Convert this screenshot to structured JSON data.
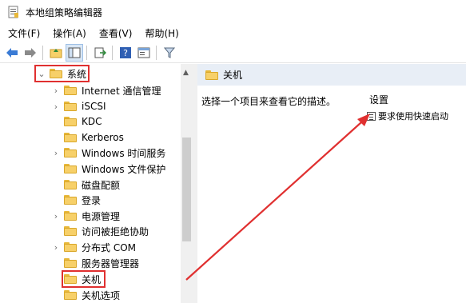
{
  "window": {
    "title": "本地组策略编辑器"
  },
  "menu": [
    "文件(F)",
    "操作(A)",
    "查看(V)",
    "帮助(H)"
  ],
  "toolbar": [
    "back-arrow-icon",
    "forward-arrow-icon",
    "up-folder-icon",
    "show-hide-tree-icon",
    "export-list-icon",
    "help-icon",
    "properties-pane-icon",
    "filter-icon"
  ],
  "tree": {
    "root": "系统",
    "items": [
      {
        "label": "Internet 通信管理",
        "expandable": true
      },
      {
        "label": "iSCSI",
        "expandable": true
      },
      {
        "label": "KDC",
        "expandable": false
      },
      {
        "label": "Kerberos",
        "expandable": false
      },
      {
        "label": "Windows 时间服务",
        "expandable": true
      },
      {
        "label": "Windows 文件保护",
        "expandable": false
      },
      {
        "label": "磁盘配额",
        "expandable": false
      },
      {
        "label": "登录",
        "expandable": false
      },
      {
        "label": "电源管理",
        "expandable": true
      },
      {
        "label": "访问被拒绝协助",
        "expandable": false
      },
      {
        "label": "分布式 COM",
        "expandable": true
      },
      {
        "label": "服务器管理器",
        "expandable": false
      },
      {
        "label": "关机",
        "expandable": false,
        "selected": true
      },
      {
        "label": "关机选项",
        "expandable": false
      }
    ]
  },
  "detail": {
    "header": "关机",
    "description": "选择一个项目来查看它的描述。",
    "settings_header": "设置",
    "settings": [
      "要求使用快速启动"
    ]
  },
  "colors": {
    "highlight_box": "#e03030",
    "arrow": "#e03030",
    "header_bg": "#e8eef6"
  }
}
